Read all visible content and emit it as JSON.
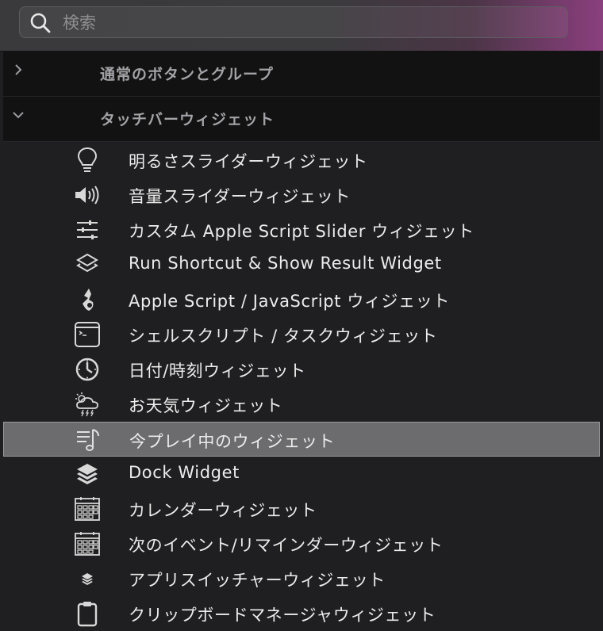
{
  "search": {
    "placeholder": "検索",
    "value": ""
  },
  "groups": [
    {
      "label": "通常のボタンとグループ",
      "expanded": false,
      "chevron": "chevron-right-icon"
    },
    {
      "label": "タッチバーウィジェット",
      "expanded": true,
      "chevron": "chevron-down-icon"
    }
  ],
  "items": [
    {
      "label": "明るさスライダーウィジェット",
      "icon": "lightbulb-icon"
    },
    {
      "label": "音量スライダーウィジェット",
      "icon": "speaker-icon"
    },
    {
      "label": "カスタム Apple Script Slider ウィジェット",
      "icon": "sliders-icon"
    },
    {
      "label": "Run Shortcut & Show Result Widget",
      "icon": "shortcut-layers-icon"
    },
    {
      "label": "Apple Script / JavaScript ウィジェット",
      "icon": "script-icon"
    },
    {
      "label": "シェルスクリプト / タスクウィジェット",
      "icon": "terminal-icon"
    },
    {
      "label": "日付/時刻ウィジェット",
      "icon": "clock-icon"
    },
    {
      "label": "お天気ウィジェット",
      "icon": "weather-icon"
    },
    {
      "label": "今プレイ中のウィジェット",
      "icon": "now-playing-icon",
      "selected": true
    },
    {
      "label": "Dock Widget",
      "icon": "dock-stack-icon"
    },
    {
      "label": "カレンダーウィジェット",
      "icon": "calendar-icon"
    },
    {
      "label": "次のイベント/リマインダーウィジェット",
      "icon": "calendar-icon"
    },
    {
      "label": "アプリスイッチャーウィジェット",
      "icon": "small-stack-icon"
    },
    {
      "label": "クリップボードマネージャウィジェット",
      "icon": "clipboard-icon"
    }
  ],
  "colors": {
    "selection": "#6c6c6e",
    "group_header_bg": "#121212",
    "panel_bg": "#1f1f21",
    "accent_gradient_end": "#8a3f7e"
  }
}
